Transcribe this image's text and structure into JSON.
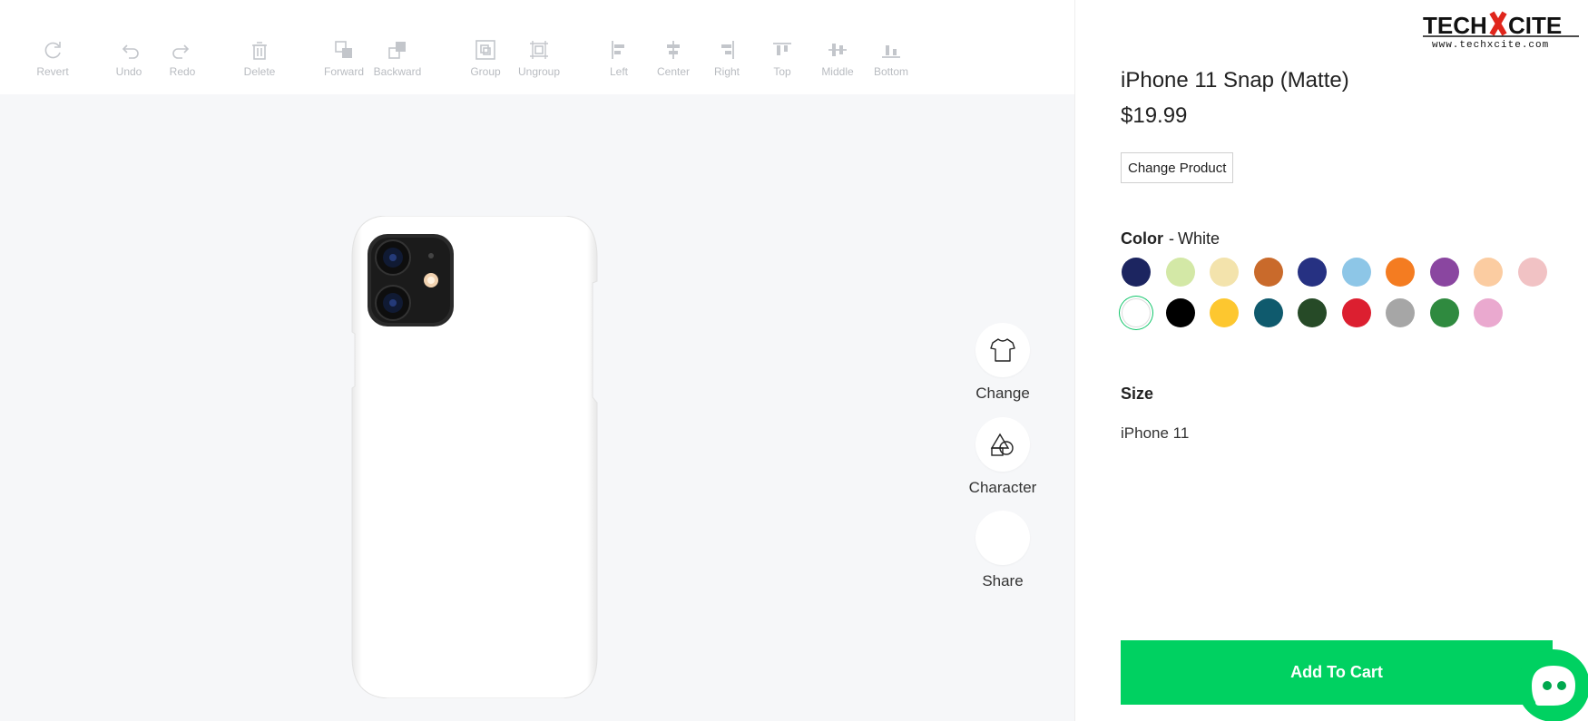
{
  "toolbar": {
    "tools": [
      {
        "label": "Revert",
        "icon": "revert-icon"
      },
      {
        "label": "Undo",
        "icon": "undo-icon"
      },
      {
        "label": "Redo",
        "icon": "redo-icon"
      },
      {
        "label": "Delete",
        "icon": "delete-icon"
      },
      {
        "label": "Forward",
        "icon": "bring-forward-icon"
      },
      {
        "label": "Backward",
        "icon": "send-backward-icon"
      },
      {
        "label": "Group",
        "icon": "group-icon"
      },
      {
        "label": "Ungroup",
        "icon": "ungroup-icon"
      },
      {
        "label": "Left",
        "icon": "align-left-icon"
      },
      {
        "label": "Center",
        "icon": "align-center-icon"
      },
      {
        "label": "Right",
        "icon": "align-right-icon"
      },
      {
        "label": "Top",
        "icon": "align-top-icon"
      },
      {
        "label": "Middle",
        "icon": "align-middle-icon"
      },
      {
        "label": "Bottom",
        "icon": "align-bottom-icon"
      }
    ]
  },
  "side_actions": [
    {
      "label": "Change",
      "icon": "tshirt-icon"
    },
    {
      "label": "Character",
      "icon": "shapes-icon"
    },
    {
      "label": "Share",
      "icon": "share-icon"
    }
  ],
  "product": {
    "title": "iPhone 11 Snap (Matte)",
    "price": "$19.99",
    "change_label": "Change Product"
  },
  "color": {
    "label": "Color",
    "separator": "-",
    "selected": "White",
    "swatches": [
      {
        "hex": "#1c2560"
      },
      {
        "hex": "#d3e8a6"
      },
      {
        "hex": "#f3e3ac"
      },
      {
        "hex": "#c96a2b"
      },
      {
        "hex": "#263182"
      },
      {
        "hex": "#8dc6e7"
      },
      {
        "hex": "#f47c21"
      },
      {
        "hex": "#8a46a0"
      },
      {
        "hex": "#fbcca1"
      },
      {
        "hex": "#f1c2c4"
      },
      {
        "hex": "#ffffff",
        "selected": true
      },
      {
        "hex": "#000000"
      },
      {
        "hex": "#fdc72f"
      },
      {
        "hex": "#0f5a6d"
      },
      {
        "hex": "#264a27"
      },
      {
        "hex": "#dc1f30"
      },
      {
        "hex": "#a6a6a6"
      },
      {
        "hex": "#2f8a3f"
      },
      {
        "hex": "#eaa9cf"
      }
    ]
  },
  "size": {
    "title": "Size",
    "value": "iPhone 11"
  },
  "cart": {
    "label": "Add To Cart"
  },
  "brand": {
    "logo_text": "TECHXCITE",
    "logo_url_text": "www.techxcite.com",
    "accent": "#00d161"
  }
}
